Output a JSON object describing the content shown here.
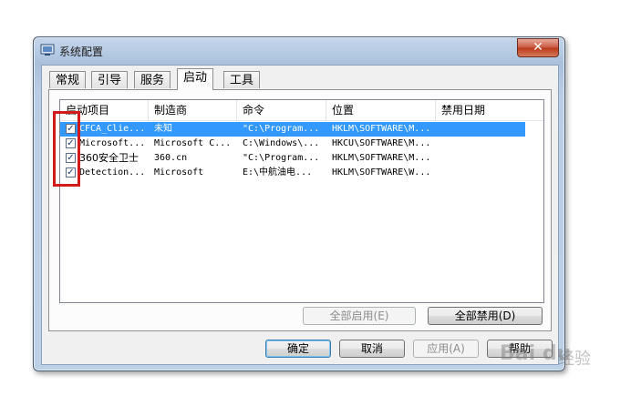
{
  "window": {
    "title": "系统配置",
    "close_label": "✕"
  },
  "tabs": [
    {
      "label": "常规"
    },
    {
      "label": "引导"
    },
    {
      "label": "服务"
    },
    {
      "label": "启动"
    },
    {
      "label": "工具"
    }
  ],
  "active_tab": "启动",
  "table": {
    "columns": [
      "启动项目",
      "制造商",
      "命令",
      "位置",
      "禁用日期"
    ],
    "rows": [
      {
        "checked": true,
        "item": "CFCA_Clie...",
        "maker": "未知",
        "command": "\"C:\\Program...",
        "location": "HKLM\\SOFTWARE\\M...",
        "date": ""
      },
      {
        "checked": true,
        "item": "Microsoft...",
        "maker": "Microsoft C...",
        "command": "C:\\Windows\\...",
        "location": "HKCU\\SOFTWARE\\M...",
        "date": ""
      },
      {
        "checked": true,
        "item": "360安全卫士",
        "maker": "360.cn",
        "command": "\"C:\\Program...",
        "location": "HKLM\\SOFTWARE\\M...",
        "date": ""
      },
      {
        "checked": true,
        "item": "Detection...",
        "maker": "Microsoft",
        "command": "E:\\中航油电...",
        "location": "HKLM\\SOFTWARE\\W...",
        "date": ""
      }
    ]
  },
  "buttons": {
    "enable_all": "全部启用(E)",
    "disable_all": "全部禁用(D)",
    "ok": "确定",
    "cancel": "取消",
    "apply": "应用(A)",
    "help": "帮助"
  },
  "watermark": {
    "logo": "Bai du",
    "sub": "经验"
  }
}
